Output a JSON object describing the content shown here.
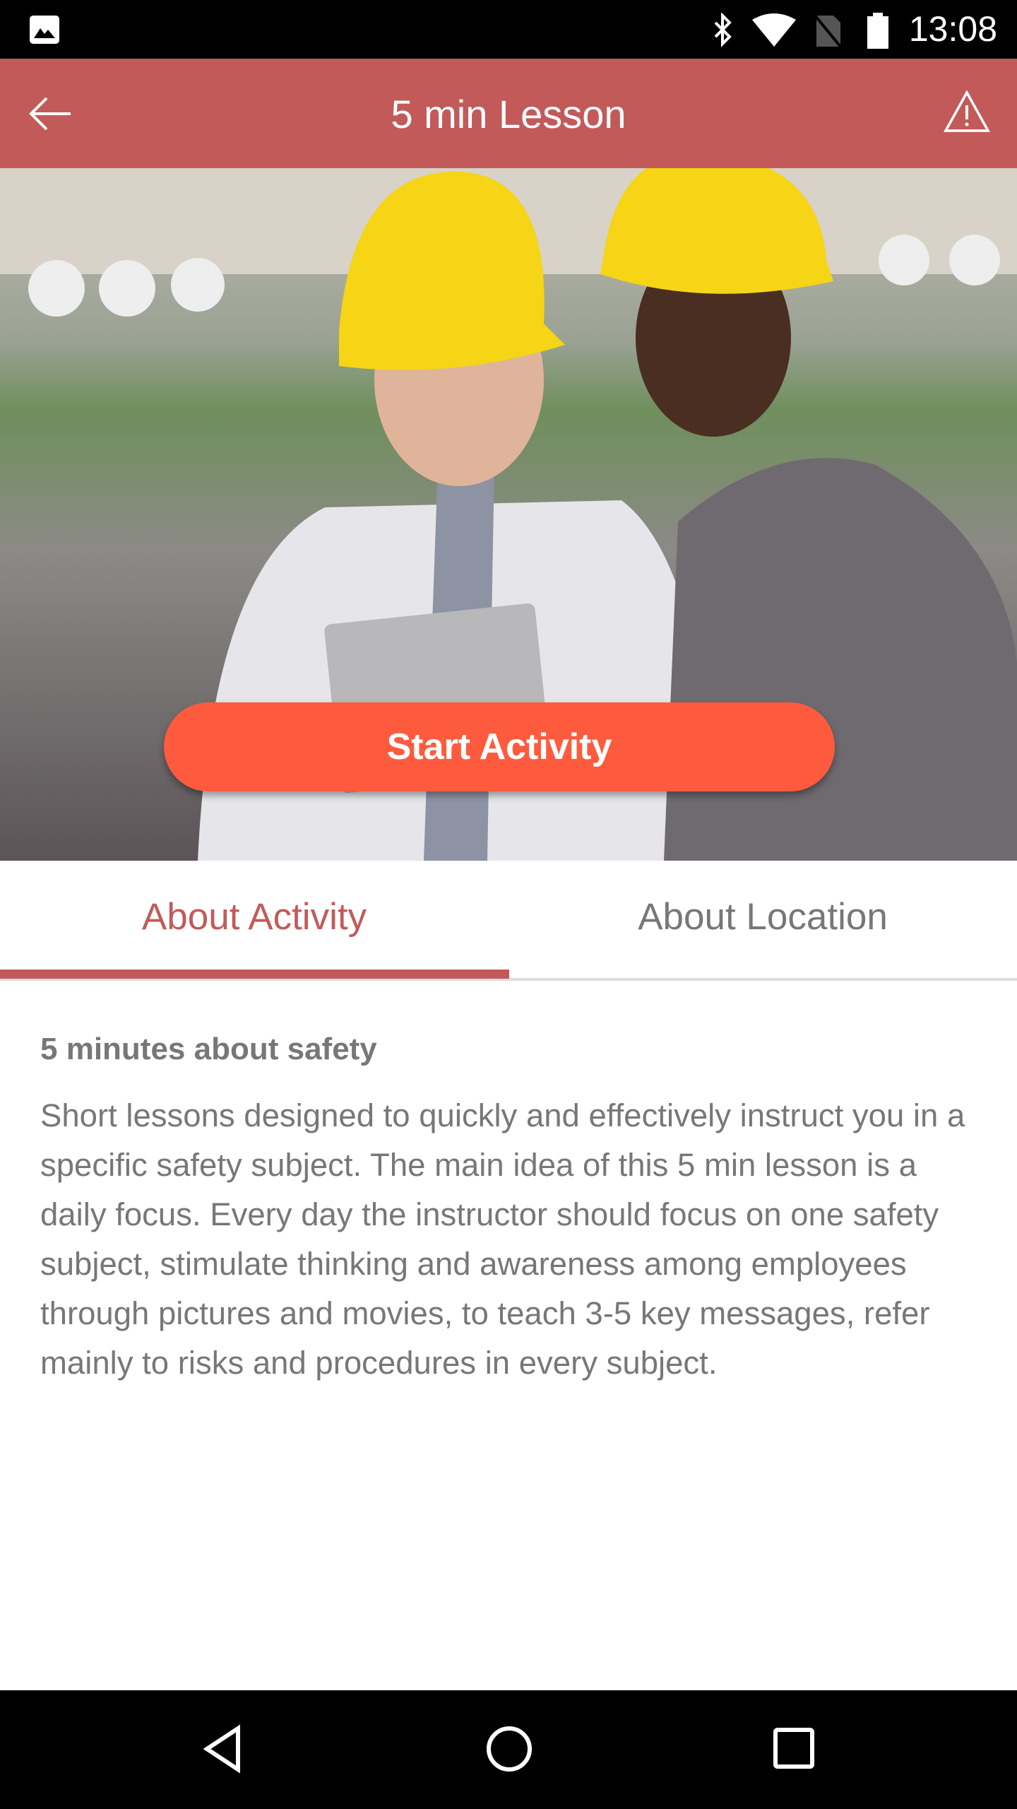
{
  "status_bar": {
    "time": "13:08",
    "icons": [
      "image-notification-icon",
      "bluetooth-icon",
      "wifi-icon",
      "no-sim-icon",
      "battery-icon"
    ]
  },
  "app_bar": {
    "title": "5 min Lesson",
    "back_icon": "arrow-left-icon",
    "action_icon": "warning-triangle-icon",
    "color": "#c25a5a"
  },
  "hero": {
    "start_button": "Start Activity",
    "button_color": "#fe5b3e"
  },
  "tabs": [
    {
      "label": "About Activity",
      "active": true
    },
    {
      "label": "About Location",
      "active": false
    }
  ],
  "content": {
    "heading": "5 minutes about safety",
    "body": "Short lessons designed to quickly and effectively instruct you in a specific safety subject. The main idea of this 5 min lesson is a daily focus. Every day the instructor should focus on one safety subject, stimulate thinking and awareness among employees through pictures and movies, to teach 3-5 key messages, refer mainly to risks and procedures in every subject."
  },
  "nav_bar": {
    "icons": [
      "back-triangle-icon",
      "home-circle-icon",
      "recents-square-icon"
    ]
  }
}
